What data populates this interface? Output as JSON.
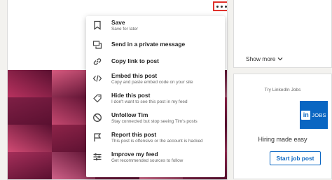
{
  "post": {
    "more_icon": "ellipsis-icon",
    "mosaic_colors": [
      "#b8325f",
      "#d65a7f",
      "#9e2a52",
      "#c43f6c",
      "#e9a3b6",
      "#7e1f45",
      "#c4486f",
      "#a33560",
      "#dd7093",
      "#b02c57",
      "#d14b74",
      "#8e2449",
      "#e27d9a",
      "#b9375f",
      "#c95079",
      "#a52f5a",
      "#cf6188",
      "#902650",
      "#d8698c",
      "#b53763"
    ]
  },
  "menu": {
    "items": [
      {
        "icon": "bookmark-icon",
        "title": "Save",
        "subtitle": "Save for later"
      },
      {
        "icon": "chat-icon",
        "title": "Send in a private message",
        "subtitle": ""
      },
      {
        "icon": "link-icon",
        "title": "Copy link to post",
        "subtitle": ""
      },
      {
        "icon": "code-icon",
        "title": "Embed this post",
        "subtitle": "Copy and paste embed code on your site"
      },
      {
        "icon": "eye-slash-icon",
        "title": "Hide this post",
        "subtitle": "I don't want to see this post in my feed"
      },
      {
        "icon": "block-icon",
        "title": "Unfollow Tim",
        "subtitle": "Stay connected but stop seeing Tim's posts"
      },
      {
        "icon": "flag-icon",
        "title": "Report this post",
        "subtitle": "This post is offensive or the account is hacked"
      },
      {
        "icon": "sliders-icon",
        "title": "Improve my feed",
        "subtitle": "Get recommended sources to follow"
      }
    ]
  },
  "sidebar": {
    "show_more": "Show more",
    "ad": {
      "try_label": "Try LinkedIn Jobs",
      "logo_in": "in",
      "logo_text": "JOBS",
      "tagline": "Hiring made easy",
      "button": "Start job post"
    }
  },
  "colors": {
    "accent": "#0a66c2",
    "highlight": "#e0312b"
  }
}
